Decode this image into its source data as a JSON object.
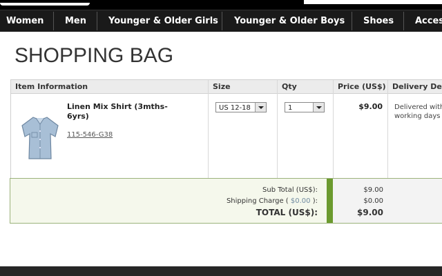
{
  "nav": {
    "items": [
      "Women",
      "Men",
      "Younger & Older Girls",
      "Younger & Older Boys",
      "Shoes",
      "Acces"
    ]
  },
  "page_title": "SHOPPING BAG",
  "table": {
    "headers": [
      "Item Information",
      "Size",
      "Qty",
      "Price (US$)",
      "Delivery Det"
    ],
    "item": {
      "name": "Linen Mix Shirt (3mths-6yrs)",
      "sku": "115-546-G38",
      "size": "US 12-18",
      "qty": "1",
      "price": "$9.00",
      "delivery_line1": "Delivered with",
      "delivery_line2": "working days"
    }
  },
  "summary": {
    "subtotal_label": "Sub Total (US$):",
    "shipping_label_pre": "Shipping Charge (",
    "shipping_link": "$0.00",
    "shipping_label_post": "):",
    "total_label": "TOTAL (US$):",
    "subtotal_value": "$9.00",
    "shipping_value": "$0.00",
    "total_value": "$9.00"
  },
  "colors": {
    "accent_green": "#6b9a2e",
    "nav_bg": "#1a1a1a"
  },
  "icons": {
    "product_image": "shirt-icon",
    "dropdown": "chevron-down-icon"
  }
}
